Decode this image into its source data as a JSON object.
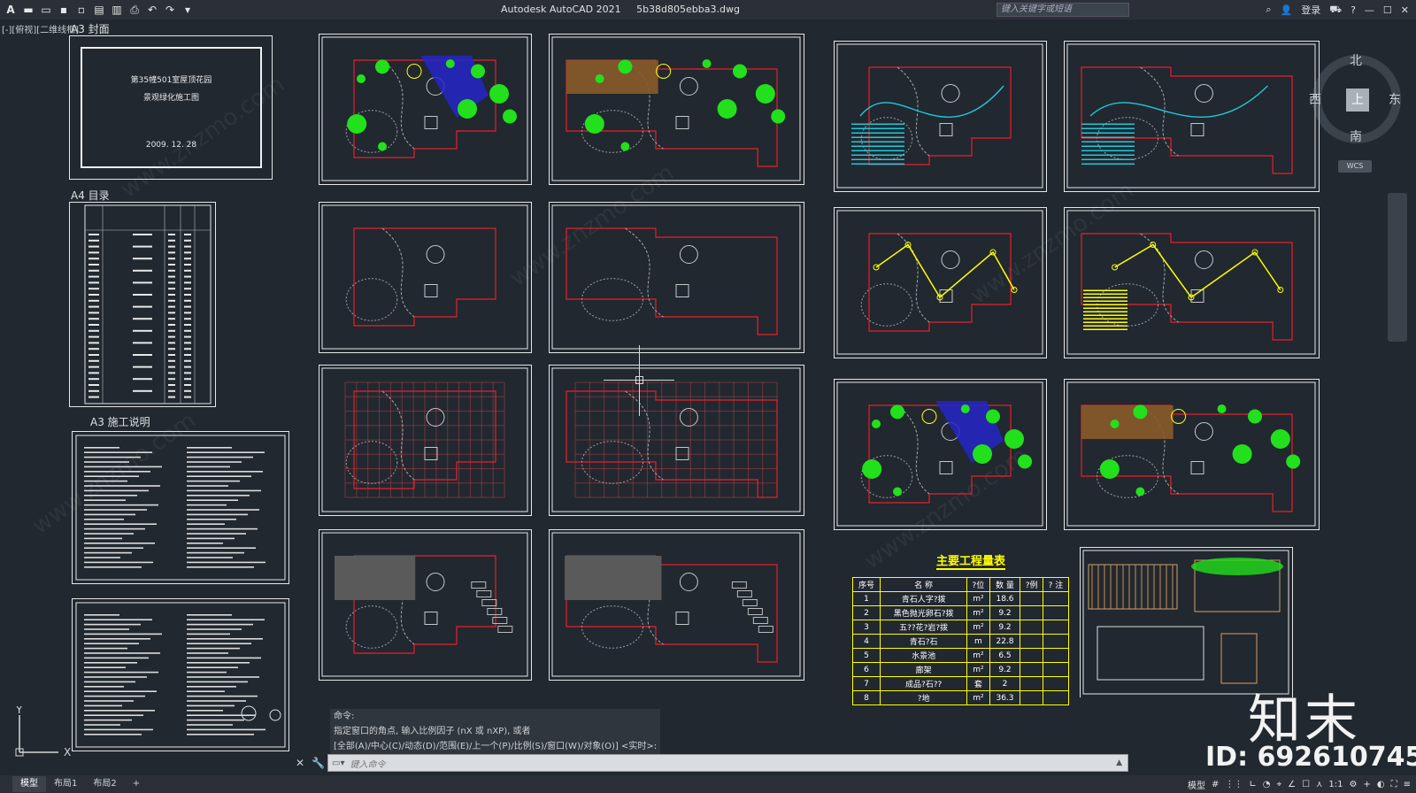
{
  "app": {
    "title": "Autodesk AutoCAD 2021",
    "filename": "5b38d805ebba3.dwg",
    "search_placeholder": "键入关键字或短语",
    "login_label": "登录"
  },
  "viewport": {
    "view_label": "[-][俯视][二维线框]"
  },
  "sheets": {
    "cover_label": "A3   封面",
    "cover_line1": "第35幢501室屋顶花园",
    "cover_line2": "景观绿化施工图",
    "cover_date": "2009. 12. 28",
    "index_label": "A4   目录",
    "notes_label": "A3   施工说明"
  },
  "compass": {
    "north": "北",
    "south": "南",
    "east": "东",
    "west": "西",
    "top": "上",
    "wcs": "WCS"
  },
  "quantity_table": {
    "title": "主要工程量表",
    "headers": [
      "序号",
      "名  称",
      "?位",
      "数 量",
      "?例",
      "?  注"
    ],
    "rows": [
      [
        "1",
        "青石人字?拨",
        "m²",
        "18.6",
        "",
        ""
      ],
      [
        "2",
        "黑色抛光卵石?拨",
        "m²",
        "9.2",
        "",
        ""
      ],
      [
        "3",
        "五??花?岩?拨",
        "m²",
        "9.2",
        "",
        ""
      ],
      [
        "4",
        "青石?石",
        "m",
        "22.8",
        "",
        ""
      ],
      [
        "5",
        "水景池",
        "m²",
        "6.5",
        "",
        ""
      ],
      [
        "6",
        "廊架",
        "m²",
        "9.2",
        "",
        ""
      ],
      [
        "7",
        "成品?石??",
        "套",
        "2",
        "",
        ""
      ],
      [
        "8",
        "?地",
        "m²",
        "36.3",
        "",
        ""
      ]
    ]
  },
  "command": {
    "history_1": "命令:",
    "history_2": "指定窗口的角点, 输入比例因子 (nX 或 nXP), 或者",
    "history_3": "[全部(A)/中心(C)/动态(D)/范围(E)/上一个(P)/比例(S)/窗口(W)/对象(O)] <实时>:",
    "input_placeholder": "键入命令"
  },
  "status": {
    "tabs": [
      "模型",
      "布局1",
      "布局2"
    ],
    "add_tab": "+",
    "model_label": "模型",
    "scale": "1:1"
  },
  "ucs": {
    "y": "Y",
    "x": "X"
  },
  "watermark": {
    "logo": "知末",
    "id": "ID: 692610745"
  },
  "colors": {
    "background": "#212830",
    "red_line": "#e8202a",
    "green": "#22e01c",
    "yellow": "#ffff00",
    "cyan": "#21c8d8",
    "blue_water": "#2424c8"
  }
}
